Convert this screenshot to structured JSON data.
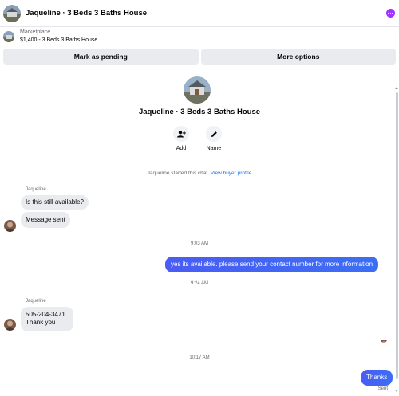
{
  "header": {
    "title": "Jaqueline · 3 Beds 3 Baths House",
    "menu_icon": "more-dots-icon",
    "accent": "#a033ff"
  },
  "listing": {
    "label": "Marketplace",
    "price_title": "$1,400 - 3 Beds 3 Baths House"
  },
  "actions": {
    "pending": "Mark as pending",
    "more": "More options"
  },
  "profile": {
    "name": "Jaqueline · 3 Beds 3 Baths House",
    "add_label": "Add",
    "name_label": "Name"
  },
  "system": {
    "started": "Jaqueline started this chat.",
    "link": "View buyer profile"
  },
  "messages": {
    "sender": "Jaqueline",
    "m1": "Is this still available?",
    "m2": "Message sent",
    "t1": "9:03 AM",
    "m3": "yes its available. please send your contact number for more information",
    "t2": "9:24 AM",
    "sender2": "Jaqueline",
    "m4_line1": "505-204-3471.",
    "m4_line2": "Thank you",
    "t3": "10:17 AM",
    "m5": "Thanks",
    "status": "Sent"
  },
  "colors": {
    "outgoing": "#4a5cf5",
    "link": "#1877f2",
    "incoming": "#e9ebee"
  }
}
